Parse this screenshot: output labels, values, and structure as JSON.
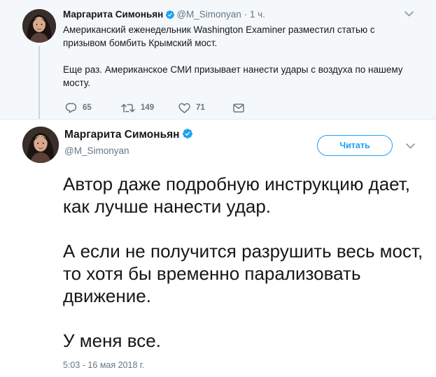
{
  "parent_tweet": {
    "name": "Маргарита Симоньян",
    "handle": "@M_Simonyan",
    "separator": "·",
    "time": "1 ч.",
    "paragraphs": [
      "Американский еженедельник Washington Examiner разместил статью с призывом бомбить Крымский мост.",
      "Еще раз. Американское СМИ призывает нанести удары с воздуха по нашему мосту."
    ],
    "actions": {
      "replies": "65",
      "retweets": "149",
      "likes": "71"
    }
  },
  "main_tweet": {
    "name": "Маргарита Симоньян",
    "handle": "@M_Simonyan",
    "follow_label": "Читать",
    "paragraphs": [
      "Автор даже подробную инструкцию дает, как лучше нанести удар.",
      "А если не получится разрушить весь мост, то хотя бы временно парализовать движение.",
      "У меня все."
    ],
    "timestamp": "5:03 - 16 мая 2018 г."
  },
  "icons": {
    "reply": "reply-icon",
    "retweet": "retweet-icon",
    "like": "heart-icon",
    "message": "envelope-icon",
    "verified": "verified-badge-icon",
    "more": "chevron-down-icon"
  },
  "colors": {
    "accent": "#1da1f2",
    "text": "#14171a",
    "secondary_text": "#657786",
    "parent_background": "#f5f8fa",
    "thread_line": "#ccd6dd"
  }
}
